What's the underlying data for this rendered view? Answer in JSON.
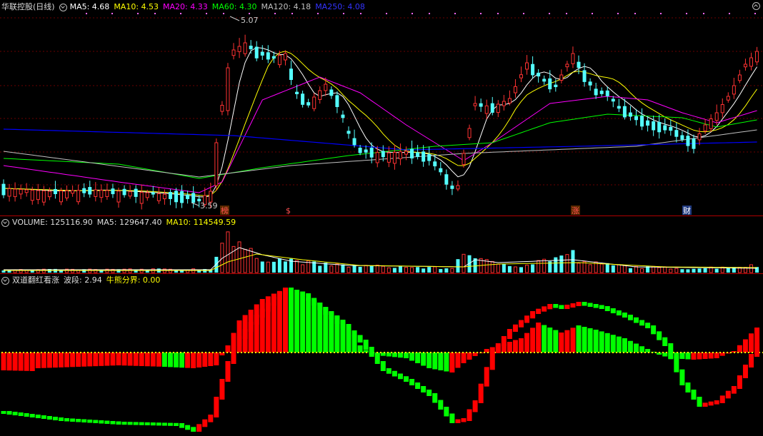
{
  "header": {
    "title": "华联控股(日线)",
    "ma5": "MA5: 4.68",
    "ma10": "MA10: 4.53",
    "ma20": "MA20: 4.33",
    "ma60": "MA60: 4.30",
    "ma120": "MA120: 4.18",
    "ma250": "MA250: 4.08"
  },
  "price_annotations": {
    "high": "5.07",
    "low": "3.59",
    "markers": [
      "榜",
      "$",
      "涨",
      "财"
    ]
  },
  "volume_header": {
    "volume": "VOLUME: 125116.90",
    "ma5": "MA5: 129647.40",
    "ma10": "MA10: 114549.59"
  },
  "indicator_header": {
    "name": "双道翻红看涨",
    "wave": "波段: 2.94",
    "boundary": "牛熊分界: 0.00"
  },
  "colors": {
    "up": "#ff3232",
    "down": "#54ffff",
    "ma5": "#ffffff",
    "ma10": "#ffff00",
    "ma20": "#ff00ff",
    "ma60": "#00ff00",
    "ma120": "#c0c0c0",
    "ma250": "#0000ff",
    "ind_red": "#ff0000",
    "ind_green": "#00ff00",
    "dots": "#ffff00"
  }
}
